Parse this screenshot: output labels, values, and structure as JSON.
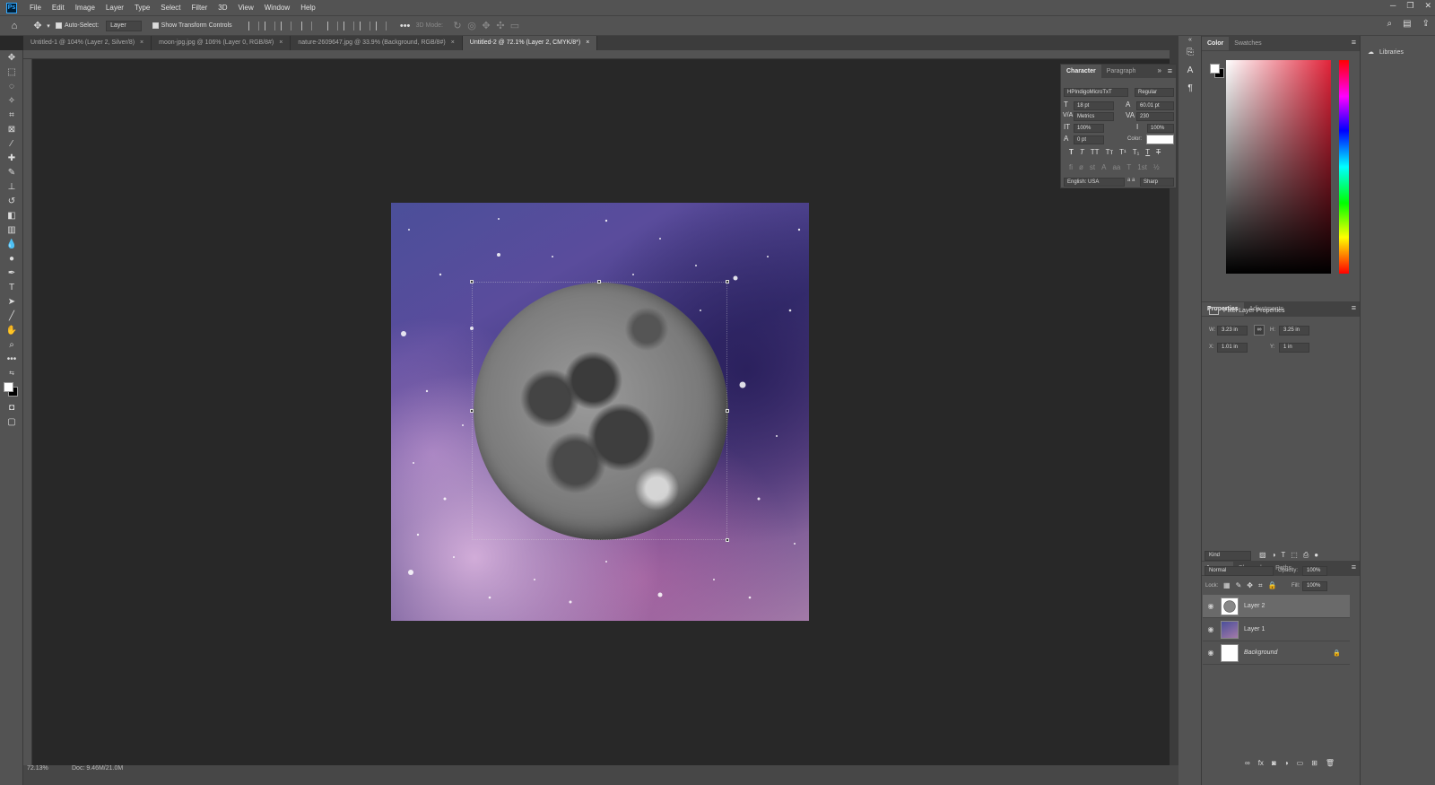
{
  "app": {
    "logo": "Ps"
  },
  "menu": [
    "File",
    "Edit",
    "Image",
    "Layer",
    "Type",
    "Select",
    "Filter",
    "3D",
    "View",
    "Window",
    "Help"
  ],
  "options": {
    "auto_select_label": "Auto-Select:",
    "auto_select_value": "Layer",
    "transform_label": "Show Transform Controls",
    "mode_3d": "3D Mode:"
  },
  "tabs": [
    {
      "label": "Untitled-1 @ 104% (Layer 2, Silver/8)",
      "active": false
    },
    {
      "label": "moon-jpg.jpg @ 106% (Layer 0, RGB/8#)",
      "active": false
    },
    {
      "label": "nature-2609647.jpg @ 33.9% (Background, RGB/8#)",
      "active": false
    },
    {
      "label": "Untitled-2 @ 72.1% (Layer 2, CMYK/8*)",
      "active": true
    }
  ],
  "status": {
    "zoom": "72.13%",
    "doc": "Doc: 9.46M/21.0M"
  },
  "character": {
    "tabs": [
      "Character",
      "Paragraph"
    ],
    "font_family": "HPIndigoMicroTxT",
    "font_style": "Regular",
    "size": "18 pt",
    "leading": "60.01 pt",
    "kerning": "Metrics",
    "tracking": "230",
    "vscale": "100%",
    "hscale": "100%",
    "baseline": "0 pt",
    "color_label": "Color:",
    "language": "English: USA",
    "antialias": "Sharp",
    "aa_label": "a a"
  },
  "color": {
    "tabs": [
      "Color",
      "Swatches"
    ],
    "hue_color": "#e2243a"
  },
  "properties": {
    "tabs": [
      "Properties",
      "Adjustments"
    ],
    "title": "Pixel Layer Properties",
    "w_label": "W:",
    "w": "3.23 in",
    "h_label": "H:",
    "h": "3.25 in",
    "x_label": "X:",
    "x": "1.01 in",
    "y_label": "Y:",
    "y": "1 in"
  },
  "layers": {
    "tabs": [
      "Layers",
      "Channels",
      "Paths"
    ],
    "kind": "Kind",
    "blend": "Normal",
    "opacity_label": "Opacity:",
    "opacity": "100%",
    "lock_label": "Lock:",
    "fill_label": "Fill:",
    "fill": "100%",
    "items": [
      {
        "name": "Layer 2",
        "active": true
      },
      {
        "name": "Layer 1",
        "active": false
      },
      {
        "name": "Background",
        "active": false
      }
    ]
  },
  "libraries": {
    "label": "Libraries"
  }
}
